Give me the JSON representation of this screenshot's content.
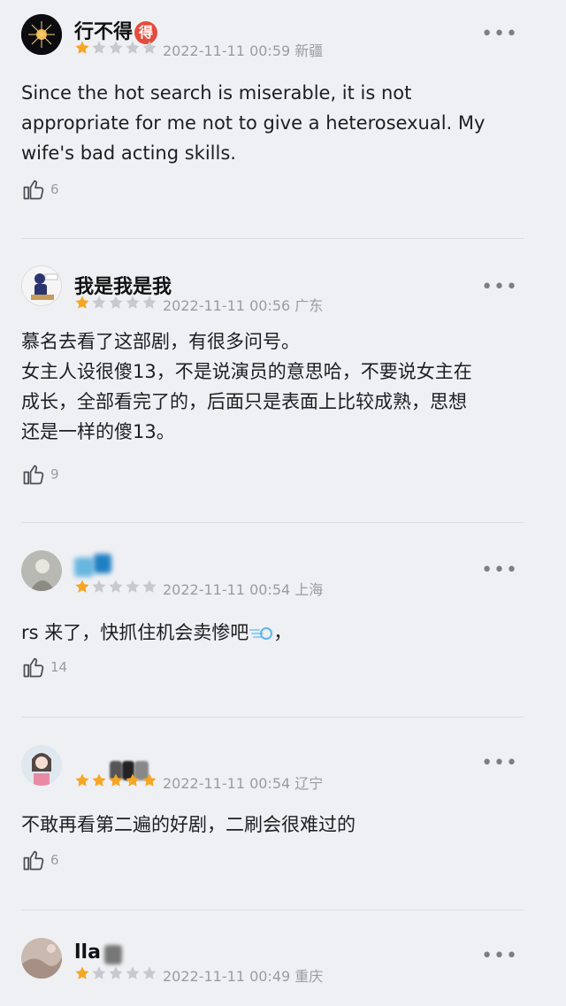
{
  "colors": {
    "star_on": "#f5a623",
    "star_off": "#c8c9ce",
    "badge": "#e34c3c",
    "meta": "#9a9ca3"
  },
  "reviews": [
    {
      "username": "行不得",
      "badge": "得",
      "rating": 1,
      "timestamp": "2022-11-11 00:59",
      "location": "新疆",
      "content_lines": [
        "Since the hot search is miserable, it is not",
        "appropriate for me not to give a heterosexual. My",
        "wife's bad acting skills."
      ],
      "likes": "6",
      "more": "•••"
    },
    {
      "username": "我是我是我",
      "rating": 1,
      "timestamp": "2022-11-11 00:56",
      "location": "广东",
      "content_lines": [
        "慕名去看了这部剧，有很多问号。",
        "女主人设很傻13，不是说演员的意思哈，不要说女主在",
        "成长，全部看完了的，后面只是表面上比较成熟，思想",
        "还是一样的傻13。"
      ],
      "likes": "9",
      "more": "•••"
    },
    {
      "username": "",
      "rating": 1,
      "timestamp": "2022-11-11 00:54",
      "location": "上海",
      "content_lines": [
        "rs 来了，快抓住机会卖惨吧",
        "，"
      ],
      "emoji": "dash-emoji",
      "likes": "14",
      "more": "•••"
    },
    {
      "username": "",
      "rating": 5,
      "timestamp": "2022-11-11 00:54",
      "location": "辽宁",
      "content_lines": [
        "不敢再看第二遍的好剧，二刷会很难过的"
      ],
      "likes": "6",
      "more": "•••"
    },
    {
      "username": "lla",
      "rating": 1,
      "timestamp": "2022-11-11 00:49",
      "location": "重庆",
      "more": "•••"
    }
  ]
}
